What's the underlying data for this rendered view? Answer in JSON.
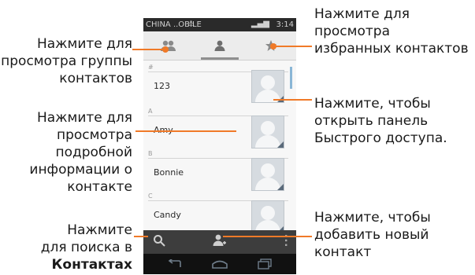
{
  "status": {
    "carrier": "CHINA ..OBILE",
    "time": "3:14"
  },
  "tabs": {
    "groups": "groups",
    "all": "all contacts",
    "favorites": "favorites"
  },
  "contacts": [
    {
      "section": "#",
      "name": "123"
    },
    {
      "section": "A",
      "name": "Amy"
    },
    {
      "section": "B",
      "name": "Bonnie"
    },
    {
      "section": "C",
      "name": "Candy"
    }
  ],
  "annotations": {
    "groups": [
      "Нажмите для",
      "просмотра группы",
      "контактов"
    ],
    "favorites": [
      "Нажмите для",
      "просмотра",
      "избранных контактов"
    ],
    "details": [
      "Нажмите для",
      "просмотра",
      "подробной",
      "информации о",
      "контакте"
    ],
    "quick": [
      "Нажмите, чтобы",
      "открыть панель",
      "Быстрого доступа."
    ],
    "search": [
      "Нажмите",
      "для поиска в",
      "Контактах"
    ],
    "add": [
      "Нажмите, чтобы",
      "добавить новый",
      "контакт"
    ]
  },
  "colors": {
    "accent": "#f07a28",
    "statusbar": "#2a2a2a",
    "actionbar": "#3d3d3d"
  }
}
